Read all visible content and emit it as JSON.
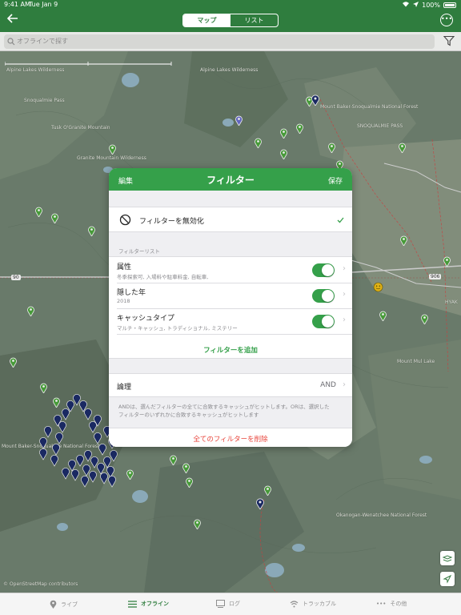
{
  "status": {
    "time": "9:41 AM",
    "date": "Tue Jan 9",
    "battery": "100%"
  },
  "nav": {
    "segments": [
      "マップ",
      "リスト"
    ],
    "selected": "マップ"
  },
  "search": {
    "placeholder": "オフラインで探す"
  },
  "map": {
    "labels": [
      "Alpine Lakes Wilderness",
      "Granite Mountain Wilderness",
      "Alpine Lakes Wilderness",
      "Tusk O'Granite Mountain",
      "Snoqualmie Pass",
      "SNOQUALMIE PASS",
      "Mount Baker-Snoqualmie National Forest",
      "Mount Baker-Snoqualmie National Forest",
      "Mount Mul Lake",
      "Okanogan-Wenatchee National Forest",
      "HYAK",
      "© OpenStreetMap contributors"
    ],
    "roads": [
      "90",
      "90",
      "906"
    ]
  },
  "dialog": {
    "edit_label": "編集",
    "title": "フィルター",
    "save_label": "保存",
    "disable_filter": "フィルターを無効化",
    "filter_list_header": "フィルターリスト",
    "filters": [
      {
        "name": "属性",
        "detail": "冬季探索可, 入場料や駐車料金, 自転車,"
      },
      {
        "name": "隠した年",
        "detail": "2018"
      },
      {
        "name": "キャッシュタイプ",
        "detail": "マルチ・キャッシュ, トラディショナル, ミステリー"
      }
    ],
    "add_filter": "フィルターを追加",
    "logic_label": "論理",
    "logic_value": "AND",
    "logic_note_1": "ANDは、選んだフィルターの全てに合致するキャッシュがヒットします。ORは、選択した",
    "logic_note_2": "フィルターのいずれかに合致するキャッシュがヒットします",
    "delete_all": "全てのフィルターを削除"
  },
  "tabs": [
    {
      "label": "ライブ",
      "icon": "location-pin-icon"
    },
    {
      "label": "オフライン",
      "icon": "list-icon"
    },
    {
      "label": "ログ",
      "icon": "log-icon"
    },
    {
      "label": "トラッカブル",
      "icon": "trackable-icon"
    },
    {
      "label": "その他",
      "icon": "more-icon"
    }
  ],
  "colors": {
    "brand_green": "#2f7d3e",
    "accent_green": "#35a04a",
    "delete_red": "#e8453c",
    "pin_navy": "#1d2d6b"
  }
}
